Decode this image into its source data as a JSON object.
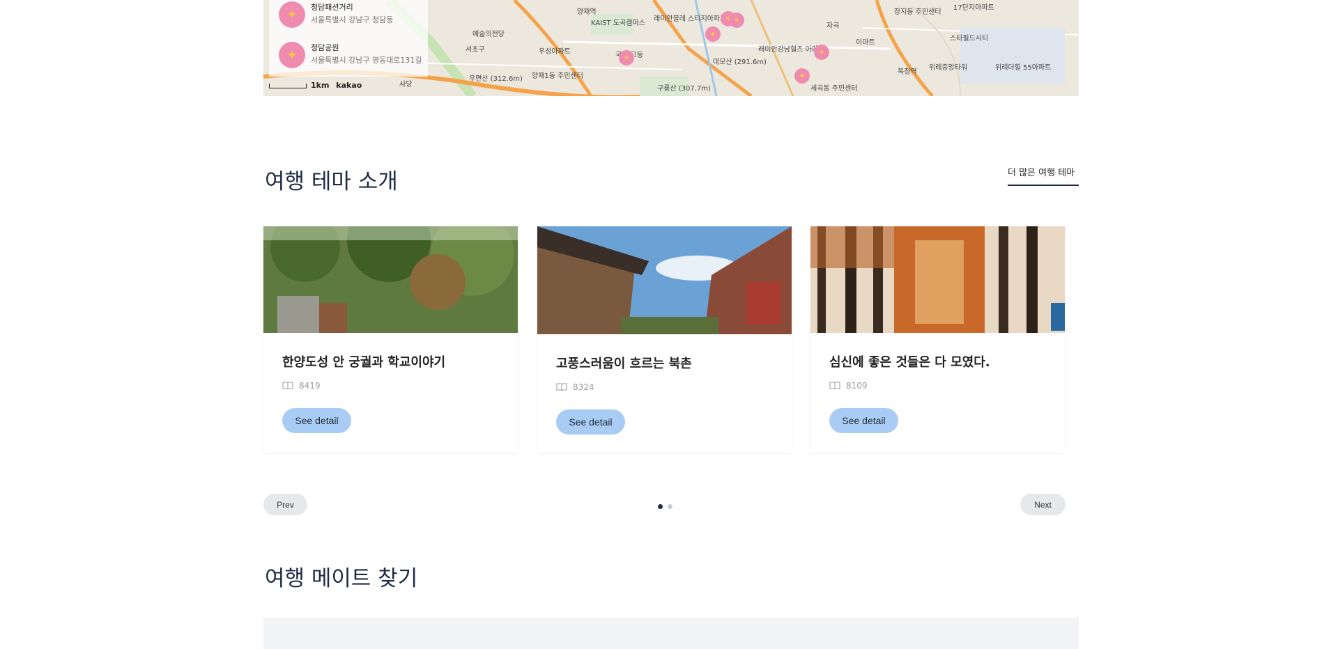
{
  "map": {
    "list": [
      {
        "title": "청담패션거리",
        "address": "서울특별시 강남구 청담동"
      },
      {
        "title": "청담공원",
        "address": "서울특별시 강남구 영동대로131길"
      }
    ],
    "scale_label": "1km",
    "provider": "kakao",
    "labels": [
      "양재역",
      "KAIST 도곡캠퍼스",
      "래미안블레 스티지아파트",
      "예술의전당",
      "서초구",
      "우성아파트",
      "국립 고등",
      "대모산 (291.6m)",
      "래미안강남힐즈 아파트",
      "우면산 (312.6m)",
      "양재1동 주민센터",
      "구룡산 (307.7m)",
      "세곡동 주민센터",
      "장지동 주민센터",
      "17단지아파트",
      "스타필드시티",
      "이마트",
      "위례중앙타워",
      "위례더힐 55아파트",
      "복정역",
      "자곡",
      "사당"
    ]
  },
  "theme_section": {
    "title": "여행 테마 소개",
    "more_link": "더 많은 여행 테마",
    "cards": [
      {
        "title": "한양도성 안 궁궐과 학교이야기",
        "count": "8419",
        "button": "See detail"
      },
      {
        "title": "고풍스러움이 흐르는 북촌",
        "count": "8324",
        "button": "See detail"
      },
      {
        "title": "심신에 좋은 것들은 다 모였다.",
        "count": "8109",
        "button": "See detail"
      }
    ],
    "prev_label": "Prev",
    "next_label": "Next",
    "dots": 2,
    "active_dot": 0
  },
  "mate_section": {
    "title": "여행 메이트 찾기"
  },
  "colors": {
    "heading": "#1d2c45",
    "button": "#a9ccf4",
    "pill": "#e6e8ec",
    "dot_active": "#1d2c45",
    "dot_inactive": "#c8ccd2",
    "marker": "#f08bb0"
  }
}
